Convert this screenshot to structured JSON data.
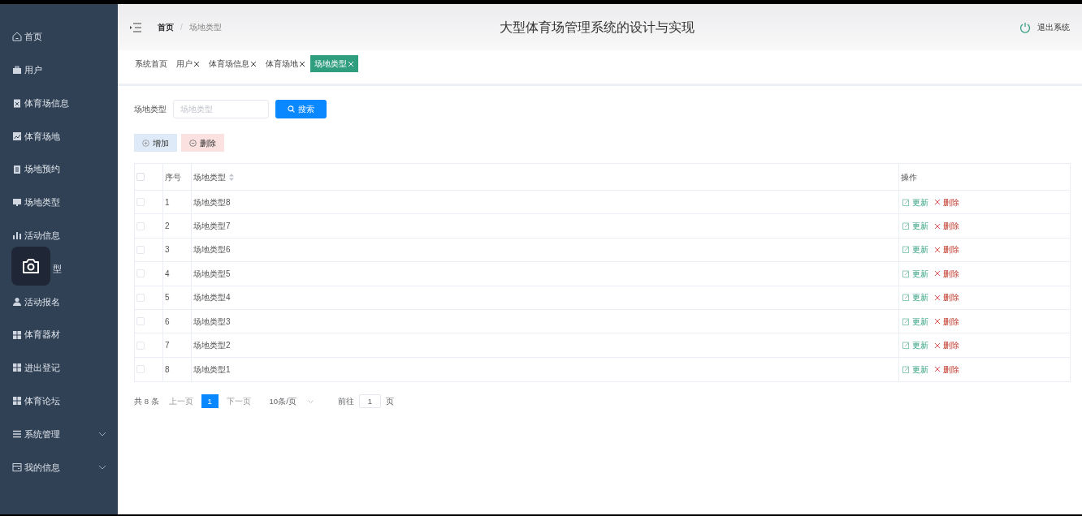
{
  "sidebar": {
    "items": [
      {
        "label": "首页",
        "kind": "home",
        "selected": false,
        "expandable": false
      },
      {
        "label": "用户",
        "kind": "briefcase",
        "selected": false,
        "expandable": false
      },
      {
        "label": "体育场信息",
        "kind": "clipboard",
        "selected": false,
        "expandable": false
      },
      {
        "label": "体育场地",
        "kind": "chart",
        "selected": false,
        "expandable": false
      },
      {
        "label": "场地预约",
        "kind": "doc",
        "selected": false,
        "expandable": false
      },
      {
        "label": "场地类型",
        "kind": "monitor",
        "selected": false,
        "expandable": false
      },
      {
        "label": "活动信息",
        "kind": "bars",
        "selected": false,
        "expandable": false
      },
      {
        "label": "型",
        "selected": false,
        "expandable": false
      },
      {
        "label": "活动报名",
        "kind": "user",
        "selected": false,
        "expandable": false
      },
      {
        "label": "体育器材",
        "kind": "grid",
        "selected": false,
        "expandable": false
      },
      {
        "label": "进出登记",
        "kind": "grid",
        "selected": false,
        "expandable": false
      },
      {
        "label": "体育论坛",
        "kind": "grid",
        "selected": false,
        "expandable": false
      },
      {
        "label": "系统管理",
        "kind": "list",
        "selected": false,
        "expandable": true
      },
      {
        "label": "我的信息",
        "kind": "card",
        "selected": false,
        "expandable": true
      }
    ]
  },
  "header": {
    "breadcrumb": [
      "首页",
      "场地类型"
    ],
    "separator": "/",
    "title": "大型体育场管理系统的设计与实现",
    "logout": "退出系统"
  },
  "tabs": [
    {
      "label": "系统首页",
      "closable": false,
      "selected": false
    },
    {
      "label": "用户",
      "closable": true,
      "selected": false
    },
    {
      "label": "体育场信息",
      "closable": true,
      "selected": false
    },
    {
      "label": "体育场地",
      "closable": true,
      "selected": false
    },
    {
      "label": "场地类型",
      "closable": true,
      "selected": true
    }
  ],
  "search": {
    "label": "场地类型",
    "placeholder": "场地类型",
    "button": "搜索"
  },
  "actions": {
    "add": "增加",
    "delete": "删除"
  },
  "table": {
    "columns": [
      "序号",
      "场地类型",
      "操作"
    ],
    "select_all_checked": false,
    "rows": [
      {
        "index": "1",
        "name": "场地类型8",
        "checked": false,
        "update": "更新",
        "delete": "删除"
      },
      {
        "index": "2",
        "name": "场地类型7",
        "checked": false,
        "update": "更新",
        "delete": "删除"
      },
      {
        "index": "3",
        "name": "场地类型6",
        "checked": false,
        "update": "更新",
        "delete": "删除"
      },
      {
        "index": "4",
        "name": "场地类型5",
        "checked": false,
        "update": "更新",
        "delete": "删除"
      },
      {
        "index": "5",
        "name": "场地类型4",
        "checked": false,
        "update": "更新",
        "delete": "删除"
      },
      {
        "index": "6",
        "name": "场地类型3",
        "checked": false,
        "update": "更新",
        "delete": "删除"
      },
      {
        "index": "7",
        "name": "场地类型2",
        "checked": false,
        "update": "更新",
        "delete": "删除"
      },
      {
        "index": "8",
        "name": "场地类型1",
        "checked": false,
        "update": "更新",
        "delete": "删除"
      }
    ]
  },
  "pagination": {
    "total": "共 8 条",
    "prev": "上一页",
    "pages": [
      {
        "label": "1",
        "selected": true
      }
    ],
    "next": "下一页",
    "page_size": "10条/页",
    "goto": "前往",
    "goto_value": "1",
    "page_unit": "页"
  }
}
